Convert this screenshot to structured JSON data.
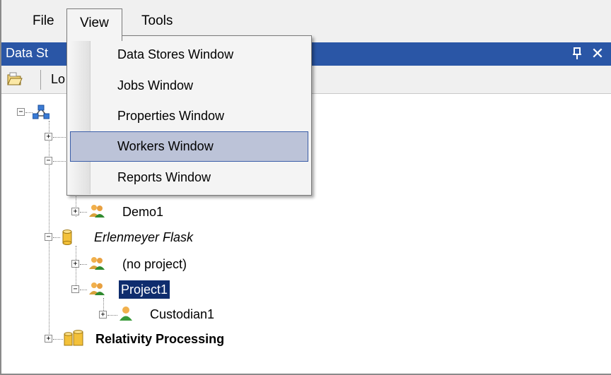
{
  "menubar": {
    "file": "File",
    "view": "View",
    "tools": "Tools"
  },
  "panel": {
    "title": "Data St",
    "pin_icon": "pin-icon",
    "close_icon": "close-icon",
    "close_glyph": "✕"
  },
  "toolbar": {
    "open_icon": "open-folder-icon",
    "label": "Lo"
  },
  "view_menu": {
    "items": [
      {
        "label": "Data Stores Window"
      },
      {
        "label": "Jobs Window"
      },
      {
        "label": "Properties Window"
      },
      {
        "label": "Workers Window",
        "highlighted": true
      },
      {
        "label": "Reports Window"
      }
    ]
  },
  "tree": {
    "nodes": [
      {
        "label": "Demo1",
        "icon": "project-group-icon",
        "expander": "+"
      },
      {
        "label": "Erlenmeyer Flask",
        "icon": "datastore-cylinder-icon",
        "expander": "−",
        "style": "italic"
      },
      {
        "label": "(no project)",
        "icon": "project-group-icon",
        "expander": "+"
      },
      {
        "label": "Project1",
        "icon": "project-group-icon",
        "expander": "−",
        "selected": true
      },
      {
        "label": "Custodian1",
        "icon": "custodian-person-icon",
        "expander": "+"
      },
      {
        "label": "Relativity Processing",
        "icon": "datastore-stack-icon",
        "expander": "+",
        "style": "bold"
      }
    ]
  },
  "colors": {
    "titlebar": "#2a56a6",
    "selection": "#0f2d6e",
    "menu_highlight": "#bcc3d8",
    "menu_highlight_border": "#3b5ea8"
  }
}
